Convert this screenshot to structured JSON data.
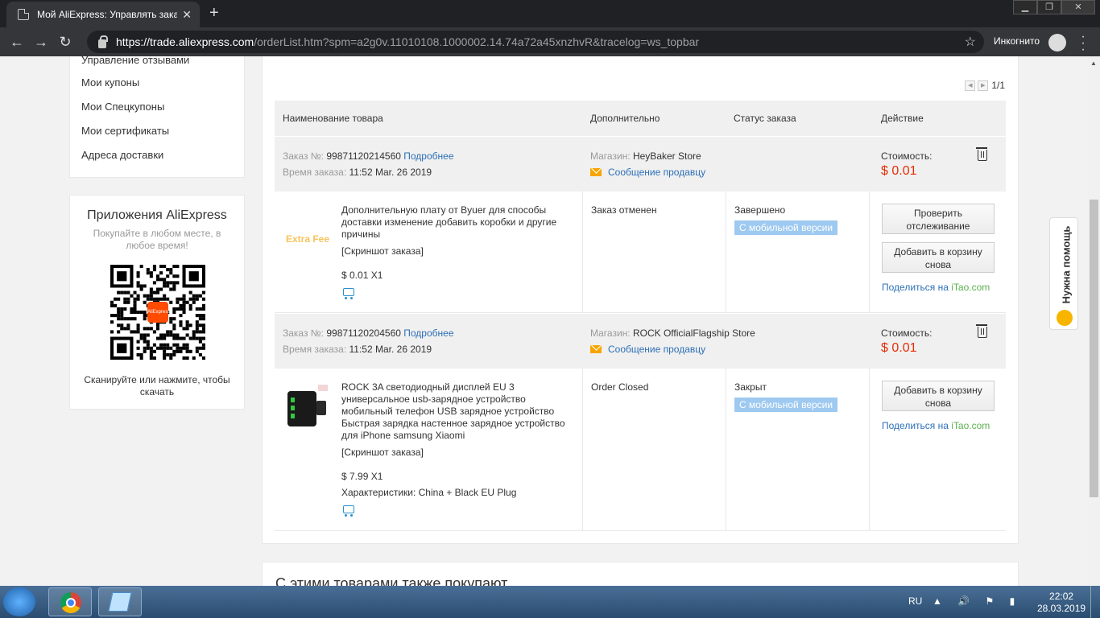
{
  "browser": {
    "tab_title": "Мой AliExpress: Управлять заказ",
    "tab_close": "✕",
    "new_tab": "+",
    "url_host": "https://trade.aliexpress.com",
    "url_rest": "/orderList.htm?spm=a2g0v.11010108.1000002.14.74a72a45xnzhvR&tracelog=ws_topbar",
    "incognito_label": "Инкогнито",
    "back": "←",
    "forward": "→",
    "reload": "↻",
    "star": "☆",
    "min": "▁",
    "max": "❐",
    "close": "✕"
  },
  "sidebar": {
    "items": [
      "Управление отзывами",
      "Мои купоны",
      "Мои Спецкупоны",
      "Мои сертификаты",
      "Адреса доставки"
    ]
  },
  "apps": {
    "title": "Приложения AliExpress",
    "subtitle": "Покупайте в любом месте, в любое время!",
    "qr_logo": "AliExpress",
    "scan": "Сканируйте или нажмите, чтобы скачать"
  },
  "pager": {
    "prev": "◀",
    "next": "▶",
    "page": "1/1"
  },
  "table_headers": {
    "product": "Наименование товара",
    "extra": "Дополнительно",
    "status": "Статус заказа",
    "action": "Действие"
  },
  "orders": [
    {
      "order_label": "Заказ №:",
      "order_number": "99871120214560",
      "details_link": "Подробнее",
      "time_label": "Время заказа:",
      "time": "11:52 Mar. 26 2019",
      "store_label": "Магазин:",
      "store": "HeyBaker Store",
      "message": "Сообщение продавцу",
      "cost_label": "Стоимость:",
      "cost": "$ 0.01",
      "image_text": "Extra Fee",
      "product_name": "Дополнительную плату от Byuer для способы доставки изменение добавить коробки и другие причины",
      "snapshot": "[Скриншот заказа]",
      "price_qty": "$ 0.01 X1",
      "characteristics": "",
      "order_status": "Заказ отменен",
      "status": "Завершено",
      "mobile_badge": "С мобильной версии",
      "btn_track": "Проверить отслеживание",
      "btn_add_cart": "Добавить в корзину снова",
      "share_prefix": "Поделиться на ",
      "share_site": "iTao.com"
    },
    {
      "order_label": "Заказ №:",
      "order_number": "99871120204560",
      "details_link": "Подробнее",
      "time_label": "Время заказа:",
      "time": "11:52 Mar. 26 2019",
      "store_label": "Магазин:",
      "store": "ROCK OfficialFlagship Store",
      "message": "Сообщение продавцу",
      "cost_label": "Стоимость:",
      "cost": "$ 0.01",
      "product_name": "ROCK 3A светодиодный дисплей EU 3 универсальное usb-зарядное устройство мобильный телефон USB зарядное устройство Быстрая зарядка настенное зарядное устройство для iPhone samsung Xiaomi",
      "snapshot": "[Скриншот заказа]",
      "price_qty": "$ 7.99 X1",
      "characteristics": "Характеристики: China + Black EU Plug",
      "order_status": "Order Closed",
      "status": "Закрыт",
      "mobile_badge": "С мобильной версии",
      "btn_add_cart": "Добавить в корзину снова",
      "share_prefix": "Поделиться на ",
      "share_site": "iTao.com"
    }
  ],
  "also_bought": "С этими товарами также покупают",
  "help": "Нужна помощь",
  "taskbar": {
    "lang": "RU",
    "tray": "▲ 🔊 ⚑ ▮",
    "time": "22:02",
    "date": "28.03.2019"
  },
  "colors": {
    "accent_link": "#2c6fb6",
    "price": "#e62e04",
    "badge": "#9ec9f0",
    "itao": "#5ab04d"
  }
}
